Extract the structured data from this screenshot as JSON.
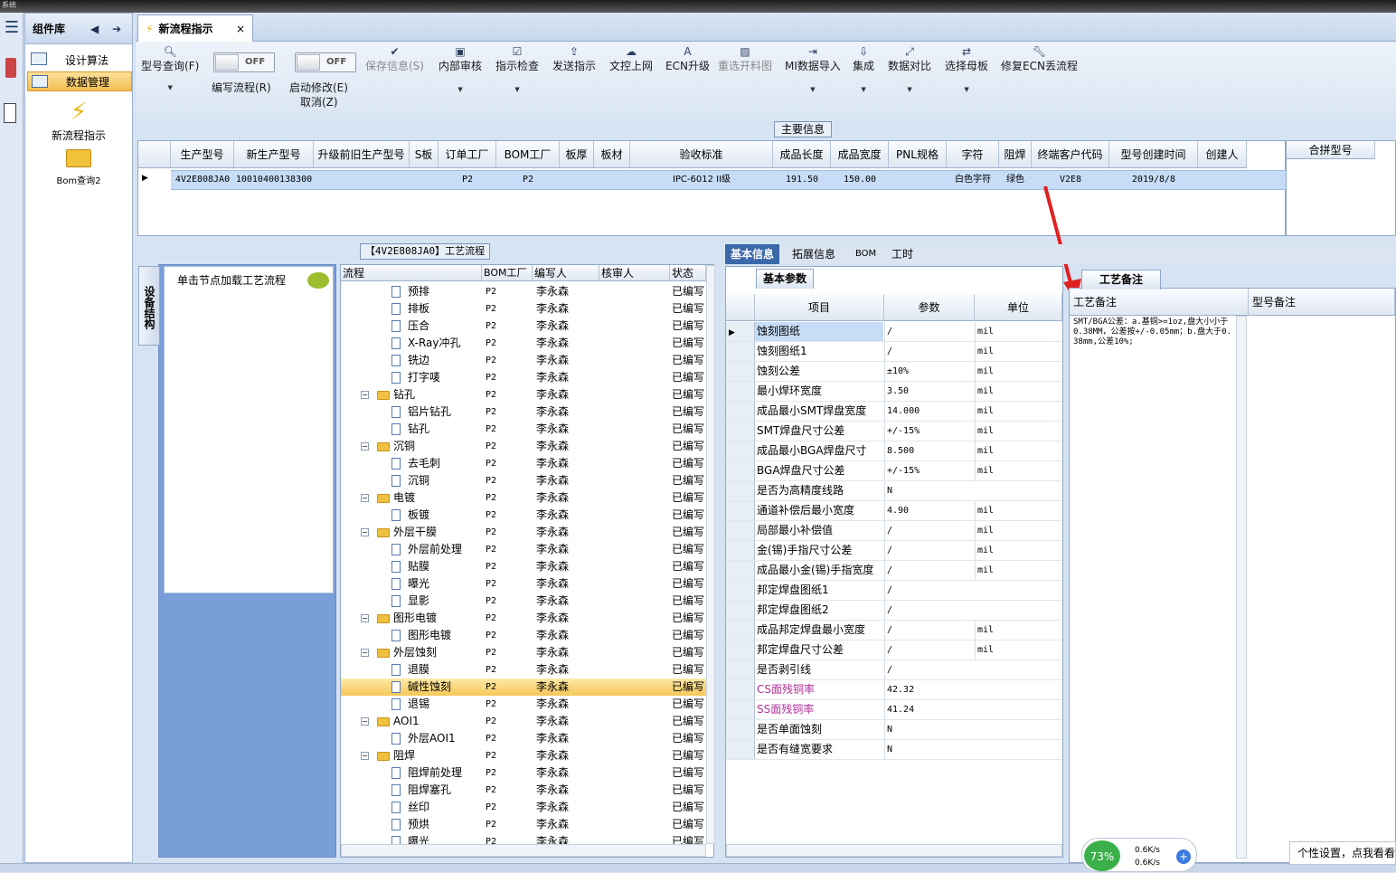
{
  "window": {
    "corner_text": "系统"
  },
  "left_panel": {
    "title": "组件库",
    "categories": [
      {
        "label": "设计算法",
        "selected": false
      },
      {
        "label": "数据管理",
        "selected": true
      }
    ],
    "tiles": [
      {
        "label": "新流程指示",
        "icon": "lightning-icon"
      },
      {
        "label": "Bom查询2",
        "icon": "folder-open-icon"
      }
    ]
  },
  "tabs": [
    {
      "label": "新流程指示",
      "close": "×"
    }
  ],
  "toolbar": {
    "items": [
      {
        "label": "型号查询(F)",
        "icon": "search-icon",
        "dropdown": true,
        "disabled": false
      },
      {
        "label": "编写流程(R)",
        "toggle": "OFF"
      },
      {
        "label": "启动修改(E)",
        "label2": "取消(Z)",
        "toggle": "OFF"
      },
      {
        "label": "保存信息(S)",
        "icon": "check-icon",
        "disabled": true
      },
      {
        "label": "内部审核",
        "icon": "print-icon",
        "dropdown": true
      },
      {
        "label": "指示检查",
        "icon": "checkbox-icon",
        "dropdown": true
      },
      {
        "label": "发送指示",
        "icon": "upload-icon"
      },
      {
        "label": "文控上网",
        "icon": "cloud-upload-icon"
      },
      {
        "label": "ECN升级",
        "icon": "font-icon"
      },
      {
        "label": "重选开料图",
        "icon": "image-icon",
        "disabled": true
      },
      {
        "label": "MI数据导入",
        "icon": "import-icon",
        "dropdown": true
      },
      {
        "label": "集成",
        "icon": "download-icon",
        "dropdown": true
      },
      {
        "label": "数据对比",
        "icon": "compare-icon",
        "dropdown": true
      },
      {
        "label": "选择母板",
        "icon": "shuffle-icon",
        "dropdown": true
      },
      {
        "label": "修复ECN丢流程",
        "icon": "wrench-icon"
      }
    ]
  },
  "main_info": {
    "label": "主要信息",
    "columns": [
      "生产型号",
      "新生产型号",
      "升级前旧生产型号",
      "S板",
      "订单工厂",
      "BOM工厂",
      "板厚",
      "板材",
      "验收标准",
      "成品长度",
      "成品宽度",
      "PNL规格",
      "字符",
      "阻焊",
      "终端客户代码",
      "型号创建时间",
      "创建人"
    ],
    "row": [
      "4V2E808JA0",
      "10010400138300",
      "",
      "",
      "P2",
      "P2",
      "",
      "",
      "IPC-6012 II级",
      "191.50",
      "150.00",
      "",
      "白色字符",
      "绿色",
      "V2E8",
      "2019/8/8",
      ""
    ],
    "merge_column": "合拼型号"
  },
  "process": {
    "title": "【4V2E808JA0】工艺流程",
    "side_tab": "设备结构",
    "hint": "单击节点加载工艺流程",
    "columns": [
      "流程",
      "BOM工厂",
      "编写人",
      "核审人",
      "状态"
    ],
    "rows": [
      {
        "name": "预排",
        "level": 2,
        "bom": "P2",
        "author": "李永森",
        "status": "已编写"
      },
      {
        "name": "排板",
        "level": 2,
        "bom": "P2",
        "author": "李永森",
        "status": "已编写"
      },
      {
        "name": "压合",
        "level": 2,
        "bom": "P2",
        "author": "李永森",
        "status": "已编写"
      },
      {
        "name": "X-Ray冲孔",
        "level": 2,
        "bom": "P2",
        "author": "李永森",
        "status": "已编写"
      },
      {
        "name": "铣边",
        "level": 2,
        "bom": "P2",
        "author": "李永森",
        "status": "已编写"
      },
      {
        "name": "打字唛",
        "level": 2,
        "bom": "P2",
        "author": "李永森",
        "status": "已编写"
      },
      {
        "name": "钻孔",
        "level": 1,
        "bom": "P2",
        "author": "李永森",
        "status": "已编写"
      },
      {
        "name": "铝片钻孔",
        "level": 2,
        "bom": "P2",
        "author": "李永森",
        "status": "已编写"
      },
      {
        "name": "钻孔",
        "level": 2,
        "bom": "P2",
        "author": "李永森",
        "status": "已编写"
      },
      {
        "name": "沉铜",
        "level": 1,
        "bom": "P2",
        "author": "李永森",
        "status": "已编写"
      },
      {
        "name": "去毛刺",
        "level": 2,
        "bom": "P2",
        "author": "李永森",
        "status": "已编写"
      },
      {
        "name": "沉铜",
        "level": 2,
        "bom": "P2",
        "author": "李永森",
        "status": "已编写"
      },
      {
        "name": "电镀",
        "level": 1,
        "bom": "P2",
        "author": "李永森",
        "status": "已编写"
      },
      {
        "name": "板镀",
        "level": 2,
        "bom": "P2",
        "author": "李永森",
        "status": "已编写"
      },
      {
        "name": "外层干膜",
        "level": 1,
        "bom": "P2",
        "author": "李永森",
        "status": "已编写"
      },
      {
        "name": "外层前处理",
        "level": 2,
        "bom": "P2",
        "author": "李永森",
        "status": "已编写"
      },
      {
        "name": "贴膜",
        "level": 2,
        "bom": "P2",
        "author": "李永森",
        "status": "已编写"
      },
      {
        "name": "曝光",
        "level": 2,
        "bom": "P2",
        "author": "李永森",
        "status": "已编写"
      },
      {
        "name": "显影",
        "level": 2,
        "bom": "P2",
        "author": "李永森",
        "status": "已编写"
      },
      {
        "name": "图形电镀",
        "level": 1,
        "bom": "P2",
        "author": "李永森",
        "status": "已编写"
      },
      {
        "name": "图形电镀",
        "level": 2,
        "bom": "P2",
        "author": "李永森",
        "status": "已编写"
      },
      {
        "name": "外层蚀刻",
        "level": 1,
        "bom": "P2",
        "author": "李永森",
        "status": "已编写"
      },
      {
        "name": "退膜",
        "level": 2,
        "bom": "P2",
        "author": "李永森",
        "status": "已编写"
      },
      {
        "name": "碱性蚀刻",
        "level": 2,
        "bom": "P2",
        "author": "李永森",
        "status": "已编写",
        "selected": true
      },
      {
        "name": "退锡",
        "level": 2,
        "bom": "P2",
        "author": "李永森",
        "status": "已编写"
      },
      {
        "name": "AOI1",
        "level": 1,
        "bom": "P2",
        "author": "李永森",
        "status": "已编写"
      },
      {
        "name": "外层AOI1",
        "level": 2,
        "bom": "P2",
        "author": "李永森",
        "status": "已编写"
      },
      {
        "name": "阻焊",
        "level": 1,
        "bom": "P2",
        "author": "李永森",
        "status": "已编写"
      },
      {
        "name": "阻焊前处理",
        "level": 2,
        "bom": "P2",
        "author": "李永森",
        "status": "已编写"
      },
      {
        "name": "阻焊塞孔",
        "level": 2,
        "bom": "P2",
        "author": "李永森",
        "status": "已编写"
      },
      {
        "name": "丝印",
        "level": 2,
        "bom": "P2",
        "author": "李永森",
        "status": "已编写"
      },
      {
        "name": "预烘",
        "level": 2,
        "bom": "P2",
        "author": "李永森",
        "status": "已编写"
      },
      {
        "name": "曝光",
        "level": 2,
        "bom": "P2",
        "author": "李永森",
        "status": "已编写"
      }
    ]
  },
  "detail_tabs": [
    "基本信息",
    "拓展信息",
    "BOM",
    "工时"
  ],
  "basic_params": {
    "tab": "基本参数",
    "columns": [
      "项目",
      "参数",
      "单位"
    ],
    "rows": [
      {
        "k": "蚀刻图纸",
        "v": "/",
        "u": "mil",
        "selected": true
      },
      {
        "k": "蚀刻图纸1",
        "v": "/",
        "u": "mil"
      },
      {
        "k": "蚀刻公差",
        "v": "±10%",
        "u": "mil"
      },
      {
        "k": "最小焊环宽度",
        "v": "3.50",
        "u": "mil"
      },
      {
        "k": "成品最小SMT焊盘宽度",
        "v": "14.000",
        "u": "mil"
      },
      {
        "k": "SMT焊盘尺寸公差",
        "v": "+/-15%",
        "u": "mil"
      },
      {
        "k": "成品最小BGA焊盘尺寸",
        "v": "8.500",
        "u": "mil"
      },
      {
        "k": "BGA焊盘尺寸公差",
        "v": "+/-15%",
        "u": "mil"
      },
      {
        "k": "是否为高精度线路",
        "v": "N",
        "u": ""
      },
      {
        "k": "通道补偿后最小宽度",
        "v": "4.90",
        "u": "mil"
      },
      {
        "k": "局部最小补偿值",
        "v": "/",
        "u": "mil"
      },
      {
        "k": "金(锡)手指尺寸公差",
        "v": "/",
        "u": "mil"
      },
      {
        "k": "成品最小金(锡)手指宽度",
        "v": "/",
        "u": "mil"
      },
      {
        "k": "邦定焊盘图纸1",
        "v": "/",
        "u": ""
      },
      {
        "k": "邦定焊盘图纸2",
        "v": "/",
        "u": ""
      },
      {
        "k": "成品邦定焊盘最小宽度",
        "v": "/",
        "u": "mil"
      },
      {
        "k": "邦定焊盘尺寸公差",
        "v": "/",
        "u": "mil"
      },
      {
        "k": "是否剥引线",
        "v": "/",
        "u": ""
      },
      {
        "k": "CS面残铜率",
        "v": "42.32",
        "u": "",
        "accent": true
      },
      {
        "k": "SS面残铜率",
        "v": "41.24",
        "u": "",
        "accent": true
      },
      {
        "k": "是否单面蚀刻",
        "v": "N",
        "u": ""
      },
      {
        "k": "是否有缝宽要求",
        "v": "N",
        "u": ""
      }
    ]
  },
  "craft_notes": {
    "tab": "工艺备注",
    "columns": [
      "工艺备注",
      "型号备注"
    ],
    "text": "SMT/BGA公差：a.基铜>=1oz,盘大小小于0.38MM，公差按+/-0.05mm；b.盘大于0.38mm,公差10%;"
  },
  "net_widget": {
    "percent": "73%",
    "up": "0.6K/s",
    "down": "0.6K/s"
  },
  "tooltip": "个性设置，点我看看",
  "colors": {
    "accent_purple": "#b0309a",
    "selection": "#c6dcf7",
    "highlight": "#f6c758",
    "annotation_arrow": "#e02020"
  }
}
